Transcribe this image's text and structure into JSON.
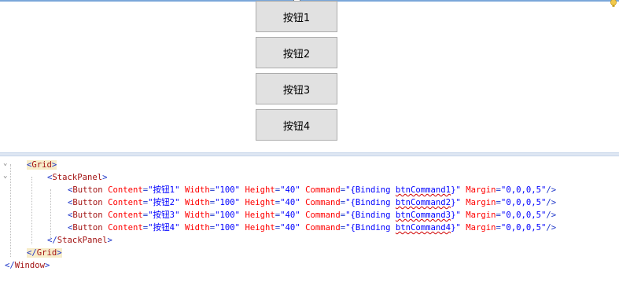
{
  "designer": {
    "buttons": [
      "按钮1",
      "按钮2",
      "按钮3",
      "按钮4"
    ]
  },
  "code": {
    "grid_open": {
      "lt": "<",
      "name": "Grid",
      "gt": ">"
    },
    "stack_open": {
      "lt": "<",
      "name": "StackPanel",
      "gt": ">"
    },
    "button_lines": [
      {
        "content": "按钮1",
        "width": "100",
        "height": "40",
        "bind_prefix": "{Binding ",
        "bind_name": "btnCommand1",
        "bind_suffix": "}",
        "margin": "0,0,0,5"
      },
      {
        "content": "按钮2",
        "width": "100",
        "height": "40",
        "bind_prefix": "{Binding ",
        "bind_name": "btnCommand2",
        "bind_suffix": "}",
        "margin": "0,0,0,5"
      },
      {
        "content": "按钮3",
        "width": "100",
        "height": "40",
        "bind_prefix": "{Binding ",
        "bind_name": "btnCommand3",
        "bind_suffix": "}",
        "margin": "0,0,0,5"
      },
      {
        "content": "按钮4",
        "width": "100",
        "height": "40",
        "bind_prefix": "{Binding ",
        "bind_name": "btnCommand4",
        "bind_suffix": "}",
        "margin": "0,0,0,5"
      }
    ],
    "stack_close": {
      "lt": "</",
      "name": "StackPanel",
      "gt": ">"
    },
    "grid_close": {
      "lt": "</",
      "name": "Grid",
      "gt": ">"
    },
    "window_close": {
      "lt": "</",
      "name": "Window",
      "gt": ">"
    },
    "labels": {
      "button_tag": "Button",
      "attr_content": "Content",
      "attr_width": "Width",
      "attr_height": "Height",
      "attr_command": "Command",
      "attr_margin": "Margin",
      "eq": "=",
      "q": "\"",
      "self_close": "/>",
      "lt": "<"
    }
  }
}
